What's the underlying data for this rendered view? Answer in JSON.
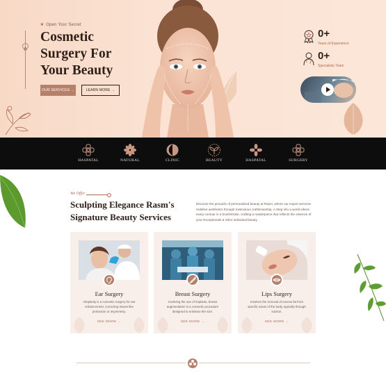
{
  "hero": {
    "tagline": "Open Your Secret",
    "headline_lines": [
      "Cosmetic",
      "Surgery For",
      "Your Beauty"
    ],
    "primary_button": "OUR SERVICES",
    "secondary_button": "LEARN MORE",
    "stats": [
      {
        "value": "0+",
        "label": "Years of Experience",
        "icon": "medal-icon"
      },
      {
        "value": "0+",
        "label": "Specialists Team",
        "icon": "doctor-icon"
      }
    ]
  },
  "strip": {
    "items": [
      {
        "label": "HASPATAL",
        "icon": "cross-flower-icon"
      },
      {
        "label": "NATURAL",
        "icon": "asterisk-flower-icon"
      },
      {
        "label": "CLINIC",
        "icon": "leaf-circle-icon"
      },
      {
        "label": "BEAUTY",
        "icon": "sprout-icon"
      },
      {
        "label": "HASPATAL",
        "icon": "asterisk-flower-icon"
      },
      {
        "label": "SURGERY",
        "icon": "cross-flower-icon"
      }
    ]
  },
  "offer": {
    "eyebrow": "We Offer",
    "title_lines": [
      "Sculpting Elegance Rasm's",
      "Signature Beauty Services"
    ],
    "description": "Discover the pinnacle of personalized beauty at Rasm, where our expert services redefine aesthetics through meticulous craftsmanship. A Step into a world where every contour is a brushstroke, crafting a masterpiece that reflects the essence of your Exceptionals & other individual beauty."
  },
  "cards": [
    {
      "name": "Ear Surgery",
      "desc": "Otoplasty is a cosmetic surgery for ear enhancement, correcting issues like protrusion or asymmetry.",
      "more": "SEE MORE"
    },
    {
      "name": "Breast Surgery",
      "desc": "Involving the use of implants, breast augmentation is a cosmetic procedure designed to enhance the size.",
      "more": "SEE MORE"
    },
    {
      "name": "Lips Surgery",
      "desc": "Involves the removal of excess fat from specific areas of the body, typically through suction.",
      "more": "SEE MORE"
    }
  ],
  "colors": {
    "accent": "#b5816b",
    "dark": "#0d0d0d",
    "peach": "#f8d9c6"
  }
}
